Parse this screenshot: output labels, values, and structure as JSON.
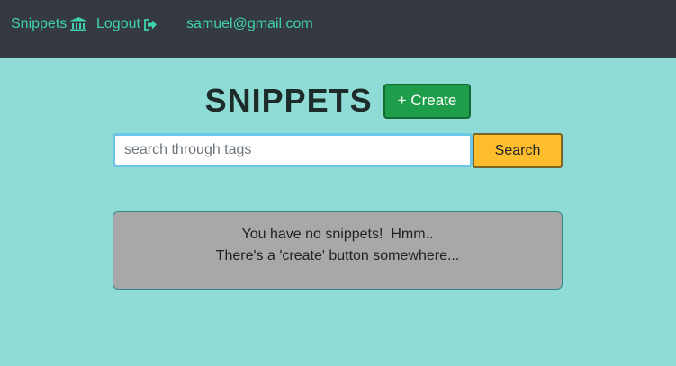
{
  "nav": {
    "snippets_label": "Snippets",
    "snippets_icon": "bank-icon",
    "logout_label": "Logout",
    "logout_icon": "sign-out-icon",
    "user_email": "samuel@gmail.com"
  },
  "header": {
    "title": "SNIPPETS",
    "create_label": "+ Create"
  },
  "search": {
    "value": "",
    "placeholder": "search through tags",
    "button_label": "Search"
  },
  "empty_state": {
    "line1": "You have no snippets!  Hmm..",
    "line2": "There's a 'create' button somewhere..."
  },
  "colors": {
    "navbar_bg": "#343a40",
    "nav_link": "#3fd1b0",
    "page_bg": "#8fdcd6",
    "create_button": "#1e9e4a",
    "search_button": "#fdbd2c",
    "empty_box": "#a8a8a8"
  }
}
